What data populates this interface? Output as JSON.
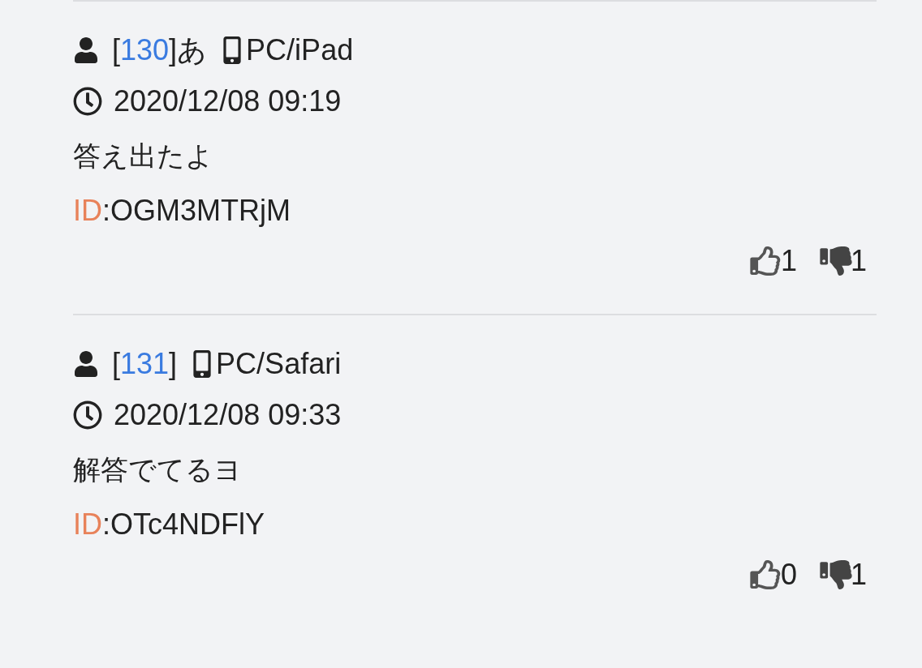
{
  "posts": [
    {
      "header": {
        "prefix": "[",
        "number": "130",
        "suffix": "]あ",
        "device": "PC/iPad"
      },
      "time": "2020/12/08 09:19",
      "body": "答え出たよ",
      "id": {
        "label": "ID",
        "value": ":OGM3MTRjM"
      },
      "likes": "1",
      "dislikes": "1"
    },
    {
      "header": {
        "prefix": "[",
        "number": "131",
        "suffix": "]",
        "device": "PC/Safari"
      },
      "time": "2020/12/08 09:33",
      "body": "解答でてるヨ\n",
      "id": {
        "label": "ID",
        "value": ":OTc4NDFlY"
      },
      "likes": "0",
      "dislikes": "1"
    }
  ]
}
